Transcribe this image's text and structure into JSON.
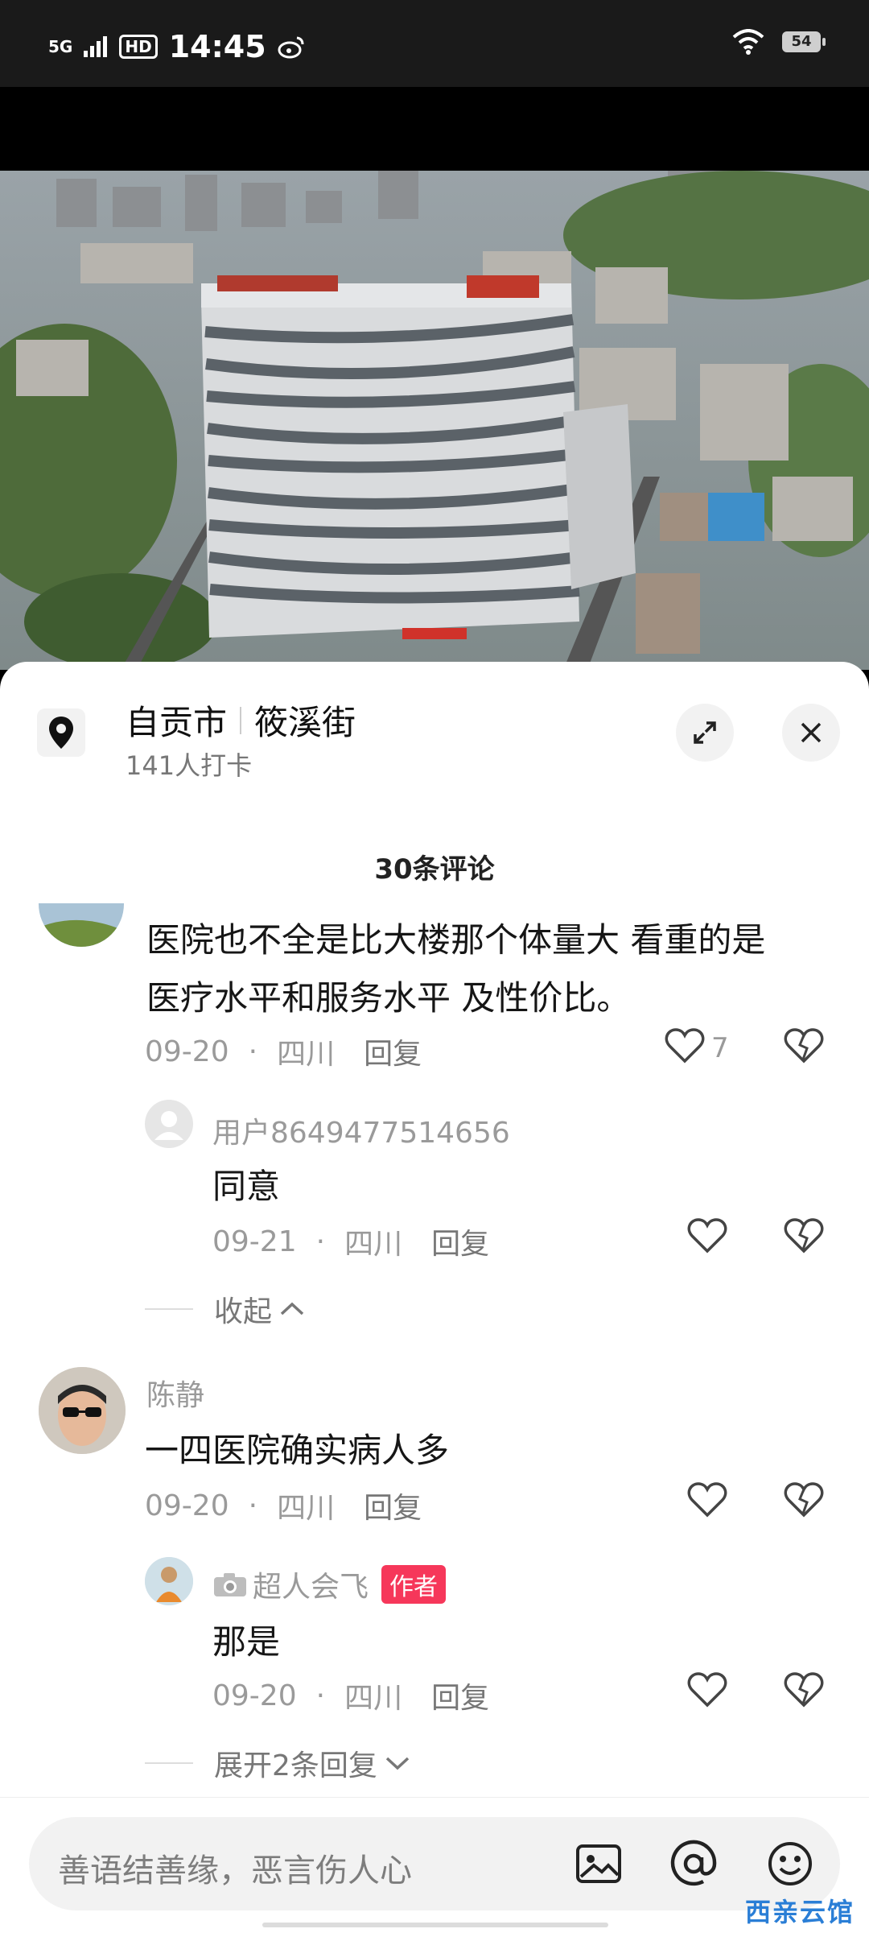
{
  "status_bar": {
    "signal": "5G",
    "hd": "HD",
    "time": "14:45",
    "battery": "54"
  },
  "location": {
    "city": "自贡市",
    "street": "筱溪街",
    "checkins": "141人打卡"
  },
  "comments_header": "30条评论",
  "comments": [
    {
      "text_line1": "医院也不全是比大楼那个体量大 看重的是",
      "text_line2": "医疗水平和服务水平 及性价比。",
      "date": "09-20",
      "dot": "·",
      "region": "四川",
      "reply": "回复",
      "likes": "7",
      "subreply": {
        "user": "用户8649477514656",
        "text": "同意",
        "date": "09-21",
        "dot": "·",
        "region": "四川",
        "reply": "回复"
      },
      "collapse": "收起"
    },
    {
      "user": "陈静",
      "text": "一四医院确实病人多",
      "date": "09-20",
      "dot": "·",
      "region": "四川",
      "reply": "回复",
      "subreply": {
        "user": "超人会飞",
        "badge": "作者",
        "text": "那是",
        "date": "09-20",
        "dot": "·",
        "region": "四川",
        "reply": "回复"
      },
      "expand": "展开2条回复"
    }
  ],
  "input": {
    "placeholder": "善语结善缘，恶言伤人心"
  },
  "watermark": "西亲云馆",
  "colors": {
    "author_badge": "#f6375a",
    "sheet_bg": "#ffffff"
  }
}
